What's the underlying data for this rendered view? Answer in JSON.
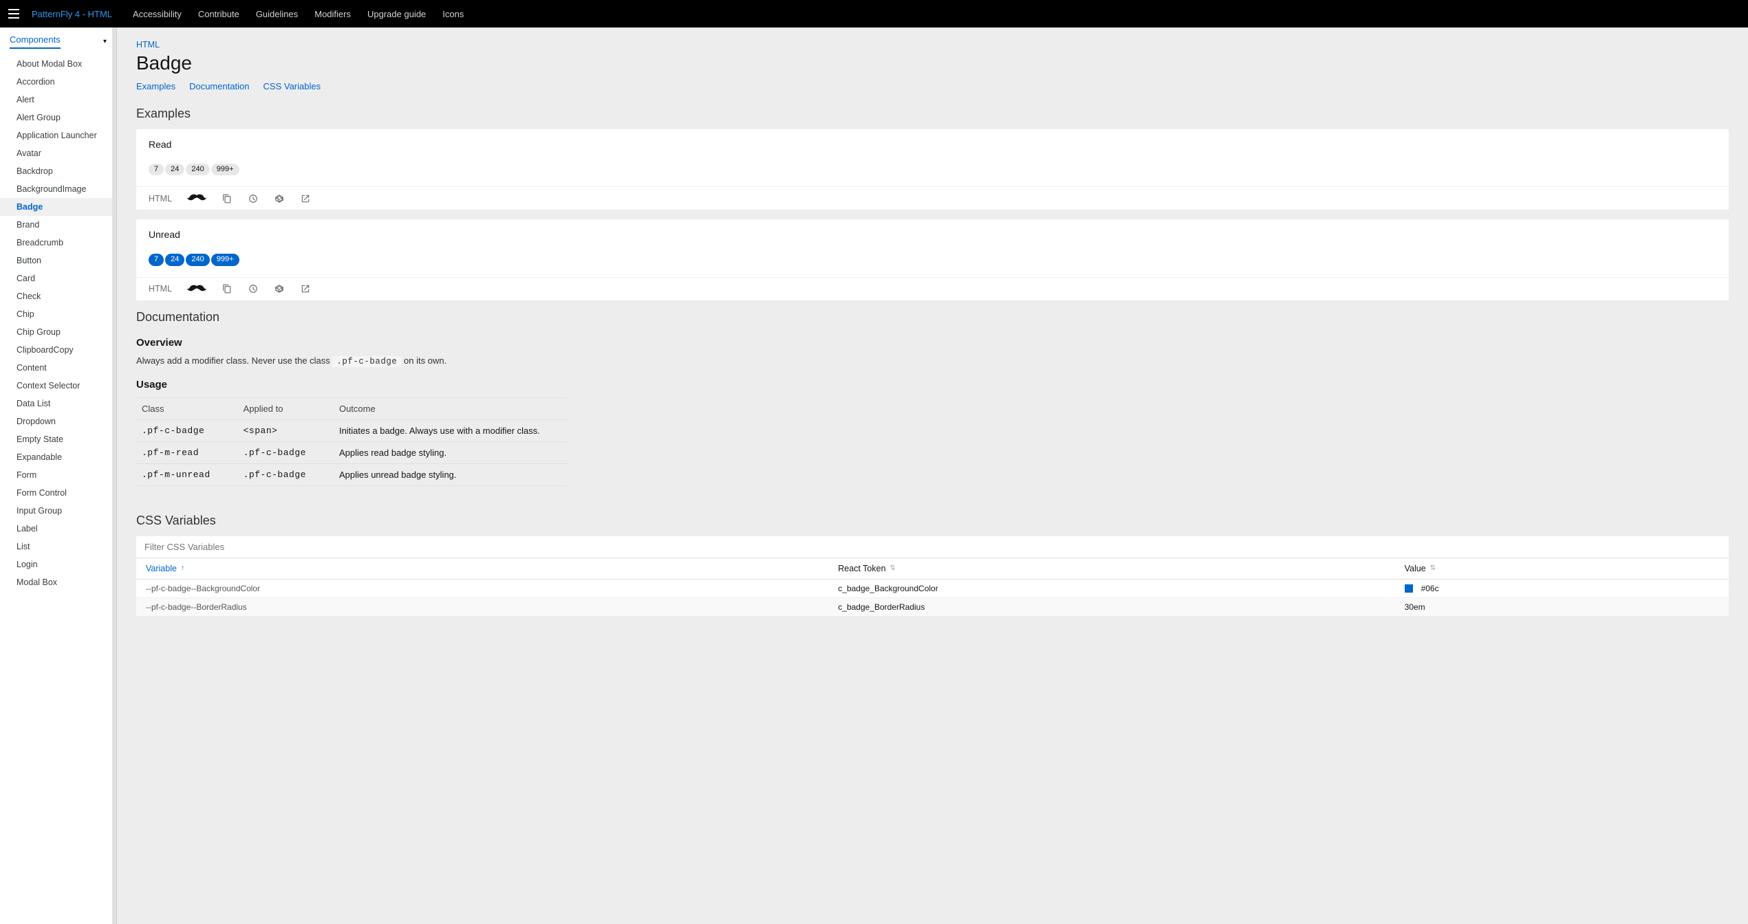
{
  "header": {
    "brand": "PatternFly 4 - HTML",
    "nav": [
      "Accessibility",
      "Contribute",
      "Guidelines",
      "Modifiers",
      "Upgrade guide",
      "Icons"
    ]
  },
  "sidebar": {
    "section": "Components",
    "items": [
      "About Modal Box",
      "Accordion",
      "Alert",
      "Alert Group",
      "Application Launcher",
      "Avatar",
      "Backdrop",
      "BackgroundImage",
      "Badge",
      "Brand",
      "Breadcrumb",
      "Button",
      "Card",
      "Check",
      "Chip",
      "Chip Group",
      "ClipboardCopy",
      "Content",
      "Context Selector",
      "Data List",
      "Dropdown",
      "Empty State",
      "Expandable",
      "Form",
      "Form Control",
      "Input Group",
      "Label",
      "List",
      "Login",
      "Modal Box"
    ],
    "active_index": 8
  },
  "breadcrumb": "HTML",
  "page_title": "Badge",
  "tabs": [
    "Examples",
    "Documentation",
    "CSS Variables"
  ],
  "sections": {
    "examples_heading": "Examples",
    "documentation_heading": "Documentation",
    "cssvars_heading": "CSS Variables"
  },
  "examples": [
    {
      "title": "Read",
      "mode": "read",
      "badges": [
        "7",
        "24",
        "240",
        "999+"
      ],
      "footer_label": "HTML"
    },
    {
      "title": "Unread",
      "mode": "unread",
      "badges": [
        "7",
        "24",
        "240",
        "999+"
      ],
      "footer_label": "HTML"
    }
  ],
  "documentation": {
    "overview_heading": "Overview",
    "overview_text_before": "Always add a modifier class. Never use the class ",
    "overview_code": ".pf-c-badge",
    "overview_text_after": " on its own.",
    "usage_heading": "Usage",
    "usage_columns": [
      "Class",
      "Applied to",
      "Outcome"
    ],
    "usage_rows": [
      {
        "class": ".pf-c-badge",
        "applied": "<span>",
        "outcome": "Initiates a badge. Always use with a modifier class."
      },
      {
        "class": ".pf-m-read",
        "applied": ".pf-c-badge",
        "outcome": "Applies read badge styling."
      },
      {
        "class": ".pf-m-unread",
        "applied": ".pf-c-badge",
        "outcome": "Applies unread badge styling."
      }
    ]
  },
  "cssvars": {
    "filter_placeholder": "Filter CSS Variables",
    "columns": {
      "variable": "Variable",
      "react_token": "React Token",
      "value": "Value"
    },
    "rows": [
      {
        "variable": "--pf-c-badge--BackgroundColor",
        "react_token": "c_badge_BackgroundColor",
        "value": "#06c",
        "swatch": "#06c"
      },
      {
        "variable": "--pf-c-badge--BorderRadius",
        "react_token": "c_badge_BorderRadius",
        "value": "30em",
        "swatch": null
      }
    ]
  }
}
